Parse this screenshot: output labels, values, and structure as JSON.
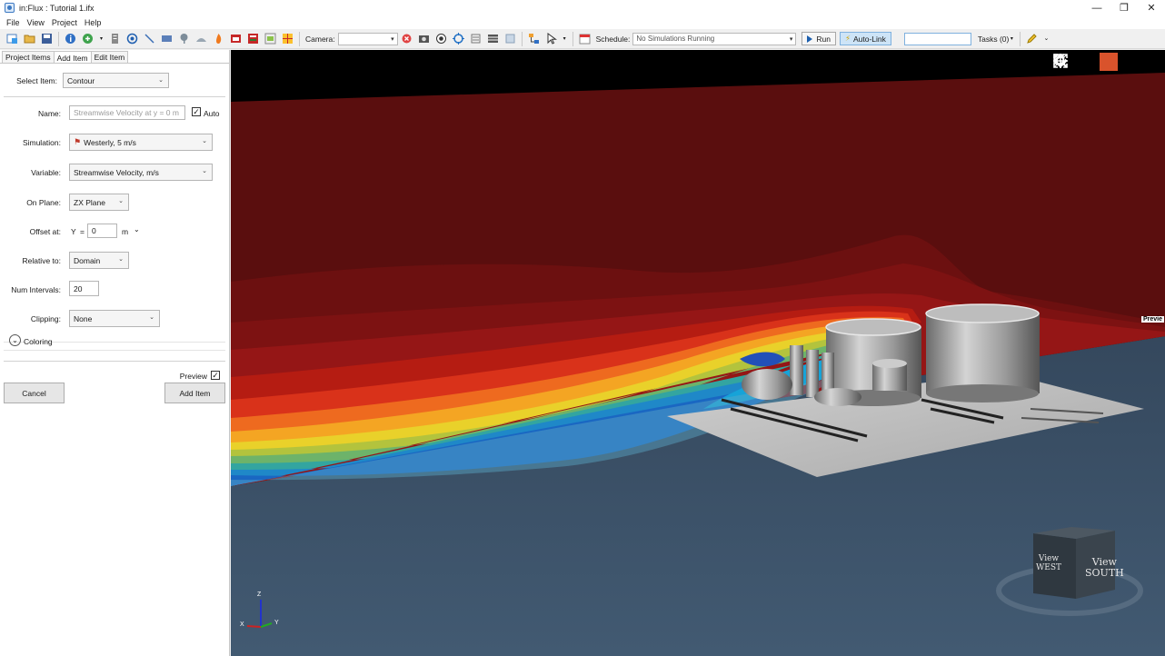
{
  "window": {
    "title": "in:Flux : Tutorial 1.ifx",
    "minimize": "—",
    "maximize": "❐",
    "close": "✕"
  },
  "menu": [
    "File",
    "View",
    "Project",
    "Help"
  ],
  "toolbar": {
    "camera_label": "Camera:",
    "camera_value": "",
    "schedule_label": "Schedule:",
    "schedule_value": "No Simulations Running",
    "run_label": "Run",
    "autolink_label": "Auto-Link",
    "tasks_label": "Tasks (0)"
  },
  "tabs": [
    "Project Items",
    "Add Item",
    "Edit Item"
  ],
  "form": {
    "select_item_label": "Select Item:",
    "select_item_value": "Contour",
    "name_label": "Name:",
    "name_value": "Streamwise Velocity at y = 0 m",
    "auto_label": "Auto",
    "auto_checked": "✓",
    "simulation_label": "Simulation:",
    "simulation_value": "Westerly, 5 m/s",
    "variable_label": "Variable:",
    "variable_value": "Streamwise Velocity, m/s",
    "on_plane_label": "On Plane:",
    "on_plane_value": "ZX Plane",
    "offset_label": "Offset at:",
    "offset_axis": "Y",
    "offset_eq": "=",
    "offset_value": "0",
    "offset_unit": "m",
    "relative_label": "Relative to:",
    "relative_value": "Domain",
    "intervals_label": "Num Intervals:",
    "intervals_value": "20",
    "clipping_label": "Clipping:",
    "clipping_value": "None",
    "coloring_label": "Coloring",
    "preview_label": "Preview",
    "preview_checked": "✓",
    "cancel_label": "Cancel",
    "add_label": "Add Item"
  },
  "viewport": {
    "preview_tag": "Previe",
    "cube_west": [
      "View",
      "WEST"
    ],
    "cube_south": [
      "View",
      "SOUTH"
    ],
    "axes": {
      "z": "Z",
      "x": "X",
      "y": "Y"
    }
  },
  "colors": {
    "accent": "#d9532c",
    "sky": "#000000",
    "ground": "#3f5368",
    "contour_high": "#7a1212"
  }
}
